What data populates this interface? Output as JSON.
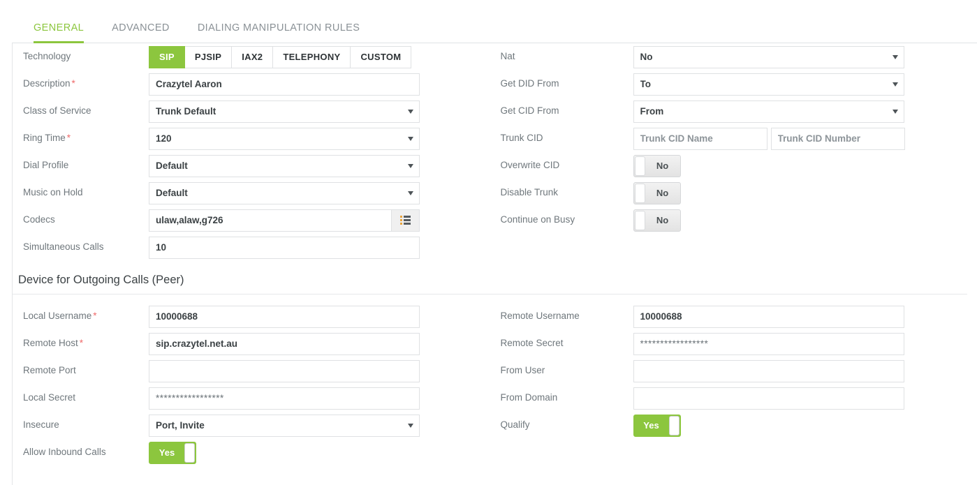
{
  "tabs": [
    {
      "label": "GENERAL",
      "active": true
    },
    {
      "label": "ADVANCED",
      "active": false
    },
    {
      "label": "DIALING MANIPULATION RULES",
      "active": false
    }
  ],
  "colors": {
    "accent_green": "#8cc63e",
    "label_gray": "#6f777c",
    "required_red": "#ef6a6a",
    "border_gray": "#dfe1e3"
  },
  "technology": {
    "label": "Technology",
    "options": [
      "SIP",
      "PJSIP",
      "IAX2",
      "TELEPHONY",
      "CUSTOM"
    ],
    "selected": "SIP"
  },
  "left_fields": {
    "description": {
      "label": "Description",
      "required": "*",
      "value": "Crazytel Aaron"
    },
    "class_of_service": {
      "label": "Class of Service",
      "value": "Trunk Default"
    },
    "ring_time": {
      "label": "Ring Time",
      "required": "*",
      "value": "120"
    },
    "dial_profile": {
      "label": "Dial Profile",
      "value": "Default"
    },
    "music_on_hold": {
      "label": "Music on Hold",
      "value": "Default"
    },
    "codecs": {
      "label": "Codecs",
      "value": "ulaw,alaw,g726",
      "icon": "list-icon"
    },
    "simultaneous_calls": {
      "label": "Simultaneous Calls",
      "value": "10"
    }
  },
  "right_fields": {
    "nat": {
      "label": "Nat",
      "value": "No"
    },
    "get_did_from": {
      "label": "Get DID From",
      "value": "To"
    },
    "get_cid_from": {
      "label": "Get CID From",
      "value": "From"
    },
    "trunk_cid": {
      "label": "Trunk CID",
      "name_placeholder": "Trunk CID Name",
      "name_value": "",
      "number_placeholder": "Trunk CID Number",
      "number_value": ""
    },
    "overwrite_cid": {
      "label": "Overwrite CID",
      "value": "No",
      "state": "off"
    },
    "disable_trunk": {
      "label": "Disable Trunk",
      "value": "No",
      "state": "off"
    },
    "continue_on_busy": {
      "label": "Continue on Busy",
      "value": "No",
      "state": "off"
    }
  },
  "section": {
    "title": "Device for Outgoing Calls (Peer)"
  },
  "peer_left": {
    "local_username": {
      "label": "Local Username",
      "required": "*",
      "value": "10000688"
    },
    "remote_host": {
      "label": "Remote Host",
      "required": "*",
      "value": "sip.crazytel.net.au"
    },
    "remote_port": {
      "label": "Remote Port",
      "value": ""
    },
    "local_secret": {
      "label": "Local Secret",
      "value": "*****************"
    },
    "insecure": {
      "label": "Insecure",
      "value": "Port, Invite"
    },
    "allow_inbound_calls": {
      "label": "Allow Inbound Calls",
      "value": "Yes",
      "state": "on"
    }
  },
  "peer_right": {
    "remote_username": {
      "label": "Remote Username",
      "value": "10000688"
    },
    "remote_secret": {
      "label": "Remote Secret",
      "value": "*****************"
    },
    "from_user": {
      "label": "From User",
      "value": ""
    },
    "from_domain": {
      "label": "From Domain",
      "value": ""
    },
    "qualify": {
      "label": "Qualify",
      "value": "Yes",
      "state": "on"
    }
  }
}
